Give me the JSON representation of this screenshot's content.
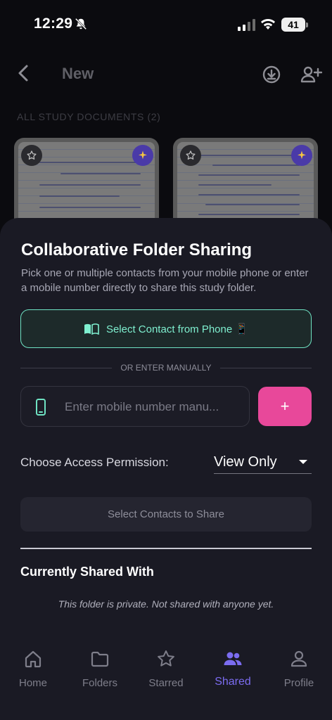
{
  "status_bar": {
    "time": "12:29",
    "battery": "41"
  },
  "header": {
    "title": "New"
  },
  "documents": {
    "section_label": "ALL STUDY DOCUMENTS (2)"
  },
  "sheet": {
    "title": "Collaborative Folder Sharing",
    "description": "Pick one or multiple contacts from your mobile phone or enter a mobile number directly to share this study folder.",
    "contact_button_label": "Select Contact from Phone 📱",
    "divider_label": "OR ENTER MANUALLY",
    "phone_placeholder": "Enter mobile number manu...",
    "phone_value": "",
    "add_button_label": "+",
    "permission_label": "Choose Access Permission:",
    "permission_value": "View Only",
    "share_button_label": "Select Contacts to Share",
    "shared_title": "Currently Shared With",
    "shared_empty": "This folder is private. Not shared with anyone yet."
  },
  "nav": {
    "items": [
      {
        "label": "Home",
        "icon": "home-icon"
      },
      {
        "label": "Folders",
        "icon": "folder-icon"
      },
      {
        "label": "Starred",
        "icon": "star-icon"
      },
      {
        "label": "Shared",
        "icon": "people-icon",
        "active": true
      },
      {
        "label": "Profile",
        "icon": "person-icon"
      }
    ]
  },
  "colors": {
    "accent_teal": "#6fe3c3",
    "accent_pink": "#e8489a",
    "accent_purple": "#7b6cf0",
    "sheet_bg": "#1a1a24"
  }
}
